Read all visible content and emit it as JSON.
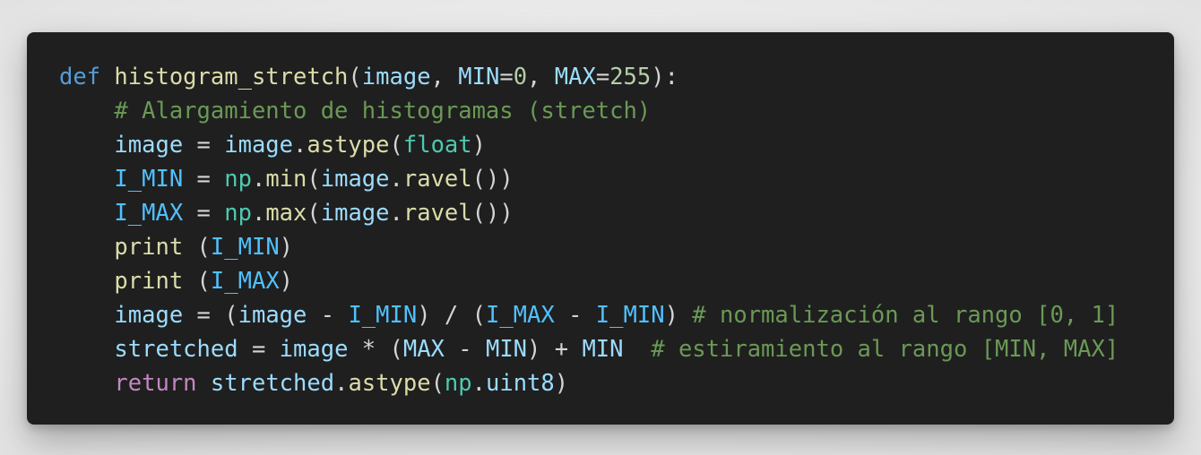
{
  "code": {
    "lines": [
      [
        {
          "t": "def",
          "k": "kw-def"
        },
        {
          "t": " ",
          "k": "op"
        },
        {
          "t": "histogram_stretch",
          "k": "fn"
        },
        {
          "t": "(",
          "k": "op"
        },
        {
          "t": "image",
          "k": "var"
        },
        {
          "t": ", ",
          "k": "op"
        },
        {
          "t": "MIN",
          "k": "var"
        },
        {
          "t": "=",
          "k": "op"
        },
        {
          "t": "0",
          "k": "num"
        },
        {
          "t": ", ",
          "k": "op"
        },
        {
          "t": "MAX",
          "k": "var"
        },
        {
          "t": "=",
          "k": "op"
        },
        {
          "t": "255",
          "k": "num"
        },
        {
          "t": "):",
          "k": "op"
        }
      ],
      [
        {
          "t": "    ",
          "k": "op"
        },
        {
          "t": "# Alargamiento de histogramas (stretch)",
          "k": "cmt"
        }
      ],
      [
        {
          "t": "    ",
          "k": "op"
        },
        {
          "t": "image",
          "k": "var"
        },
        {
          "t": " = ",
          "k": "op"
        },
        {
          "t": "image",
          "k": "var"
        },
        {
          "t": ".",
          "k": "op"
        },
        {
          "t": "astype",
          "k": "fn"
        },
        {
          "t": "(",
          "k": "op"
        },
        {
          "t": "float",
          "k": "type"
        },
        {
          "t": ")",
          "k": "op"
        }
      ],
      [
        {
          "t": "    ",
          "k": "op"
        },
        {
          "t": "I_MIN",
          "k": "const"
        },
        {
          "t": " = ",
          "k": "op"
        },
        {
          "t": "np",
          "k": "type"
        },
        {
          "t": ".",
          "k": "op"
        },
        {
          "t": "min",
          "k": "fn"
        },
        {
          "t": "(",
          "k": "op"
        },
        {
          "t": "image",
          "k": "var"
        },
        {
          "t": ".",
          "k": "op"
        },
        {
          "t": "ravel",
          "k": "fn"
        },
        {
          "t": "())",
          "k": "op"
        }
      ],
      [
        {
          "t": "    ",
          "k": "op"
        },
        {
          "t": "I_MAX",
          "k": "const"
        },
        {
          "t": " = ",
          "k": "op"
        },
        {
          "t": "np",
          "k": "type"
        },
        {
          "t": ".",
          "k": "op"
        },
        {
          "t": "max",
          "k": "fn"
        },
        {
          "t": "(",
          "k": "op"
        },
        {
          "t": "image",
          "k": "var"
        },
        {
          "t": ".",
          "k": "op"
        },
        {
          "t": "ravel",
          "k": "fn"
        },
        {
          "t": "())",
          "k": "op"
        }
      ],
      [
        {
          "t": "    ",
          "k": "op"
        },
        {
          "t": "print",
          "k": "fn"
        },
        {
          "t": " (",
          "k": "op"
        },
        {
          "t": "I_MIN",
          "k": "const"
        },
        {
          "t": ")",
          "k": "op"
        }
      ],
      [
        {
          "t": "    ",
          "k": "op"
        },
        {
          "t": "print",
          "k": "fn"
        },
        {
          "t": " (",
          "k": "op"
        },
        {
          "t": "I_MAX",
          "k": "const"
        },
        {
          "t": ")",
          "k": "op"
        }
      ],
      [
        {
          "t": "    ",
          "k": "op"
        },
        {
          "t": "image",
          "k": "var"
        },
        {
          "t": " = (",
          "k": "op"
        },
        {
          "t": "image",
          "k": "var"
        },
        {
          "t": " - ",
          "k": "op"
        },
        {
          "t": "I_MIN",
          "k": "const"
        },
        {
          "t": ") / (",
          "k": "op"
        },
        {
          "t": "I_MAX",
          "k": "const"
        },
        {
          "t": " - ",
          "k": "op"
        },
        {
          "t": "I_MIN",
          "k": "const"
        },
        {
          "t": ") ",
          "k": "op"
        },
        {
          "t": "# normalización al rango [0, 1]",
          "k": "cmt"
        }
      ],
      [
        {
          "t": "    ",
          "k": "op"
        },
        {
          "t": "stretched",
          "k": "var"
        },
        {
          "t": " = ",
          "k": "op"
        },
        {
          "t": "image",
          "k": "var"
        },
        {
          "t": " * (",
          "k": "op"
        },
        {
          "t": "MAX",
          "k": "var"
        },
        {
          "t": " - ",
          "k": "op"
        },
        {
          "t": "MIN",
          "k": "var"
        },
        {
          "t": ") + ",
          "k": "op"
        },
        {
          "t": "MIN",
          "k": "var"
        },
        {
          "t": "  ",
          "k": "op"
        },
        {
          "t": "# estiramiento al rango [MIN, MAX]",
          "k": "cmt"
        }
      ],
      [
        {
          "t": "    ",
          "k": "op"
        },
        {
          "t": "return",
          "k": "kw-ctrl"
        },
        {
          "t": " ",
          "k": "op"
        },
        {
          "t": "stretched",
          "k": "var"
        },
        {
          "t": ".",
          "k": "op"
        },
        {
          "t": "astype",
          "k": "fn"
        },
        {
          "t": "(",
          "k": "op"
        },
        {
          "t": "np",
          "k": "type"
        },
        {
          "t": ".",
          "k": "op"
        },
        {
          "t": "uint8",
          "k": "var"
        },
        {
          "t": ")",
          "k": "op"
        }
      ]
    ]
  },
  "colors": {
    "background": "#1f1f1f",
    "keyword": "#569cd6",
    "control": "#c586c0",
    "function": "#dcdcaa",
    "variable": "#9cdcfe",
    "constant": "#4fc1ff",
    "number": "#b5cea8",
    "type": "#4ec9b0",
    "comment": "#6a9955"
  }
}
